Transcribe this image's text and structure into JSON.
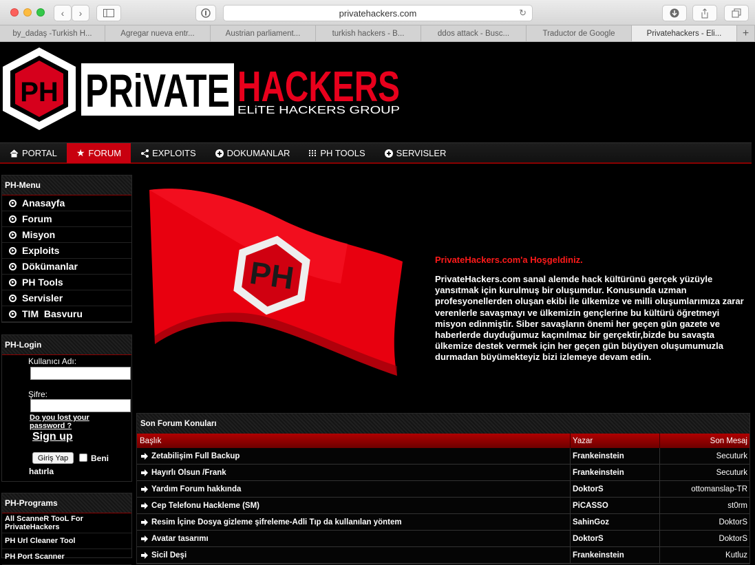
{
  "browser": {
    "url": "privatehackers.com",
    "tabs": [
      "by_dadaş -Turkish H...",
      "Agregar nueva entr...",
      "Austrian parliament...",
      "turkish hackers - B...",
      "ddos attack - Busc...",
      "Traductor de Google",
      "Privatehackers - Eli..."
    ],
    "active_tab": 6
  },
  "logo": {
    "letters": "PH",
    "word1": "PRiVATE",
    "word2": "HACKERS",
    "tagline": "ELiTE HACKERS GROUP"
  },
  "nav": [
    {
      "label": "PORTAL",
      "icon": "home-icon"
    },
    {
      "label": "FORUM",
      "icon": "star-icon"
    },
    {
      "label": "EXPLOITS",
      "icon": "share-icon"
    },
    {
      "label": "DOKUMANLAR",
      "icon": "plus-circle-icon"
    },
    {
      "label": "PH TOOLS",
      "icon": "grid-icon"
    },
    {
      "label": "SERVISLER",
      "icon": "plus-circle-icon"
    }
  ],
  "menu": {
    "title": "PH-Menu",
    "items": [
      "Anasayfa",
      "Forum",
      "Misyon",
      "Exploits",
      "Dökümanlar",
      "PH Tools",
      "Servisler",
      "TIM  Basvuru"
    ]
  },
  "login": {
    "title": "PH-Login",
    "username_label": "Kullanıcı Adı:",
    "password_label": "Şifre:",
    "lost_password": "Do you lost your password ?",
    "signup": "Sign up",
    "submit": "Giriş Yap",
    "remember": "Beni hatırla"
  },
  "programs": {
    "title": "PH-Programs",
    "items": [
      "All ScanneR TooL For PrivateHackers",
      "PH Url Cleaner Tool",
      "PH Port Scanner"
    ]
  },
  "welcome": {
    "title": "PrivateHackers.com'a Hoşgeldiniz.",
    "body": "PrivateHackers.com sanal alemde hack kültürünü gerçek yüzüyle yansıtmak için kurulmuş bir oluşumdur. Konusunda uzman profesyonellerden oluşan ekibi ile ülkemize ve milli oluşumlarımıza zarar verenlerle savaşmayı ve ülkemizin gençlerine bu kültürü öğretmeyi misyon edinmiştir. Siber savaşların önemi her geçen gün gazete ve haberlerde duyduğumuz kaçınılmaz bir gerçektir,bizde bu savaşta ülkemize destek vermek için her geçen gün büyüyen oluşumumuzla durmadan büyümekteyiz bizi izlemeye devam edin."
  },
  "forum": {
    "title": "Son Forum Konuları",
    "columns": [
      "Başlık",
      "Yazar",
      "Son Mesaj"
    ],
    "rows": [
      {
        "title": "Zetabilişim Full Backup",
        "author": "Frankeinstein",
        "last": "Secuturk"
      },
      {
        "title": "Hayırlı Olsun /Frank",
        "author": "Frankeinstein",
        "last": "Secuturk"
      },
      {
        "title": "Yardım Forum hakkında",
        "author": "DoktorS",
        "last": "ottomanslap-TR"
      },
      {
        "title": "Cep Telefonu Hackleme (SM)",
        "author": "PiCASSO",
        "last": "st0rm"
      },
      {
        "title": "Resim İçine Dosya gizleme şifreleme-Adli Tıp da kullanılan yöntem",
        "author": "SahinGoz",
        "last": "DoktorS"
      },
      {
        "title": "Avatar tasarımı",
        "author": "DoktorS",
        "last": "DoktorS"
      },
      {
        "title": "Sicil Deşi",
        "author": "Frankeinstein",
        "last": "Kutluz"
      }
    ]
  },
  "colors": {
    "accent": "#c8000f",
    "background": "#000000"
  }
}
